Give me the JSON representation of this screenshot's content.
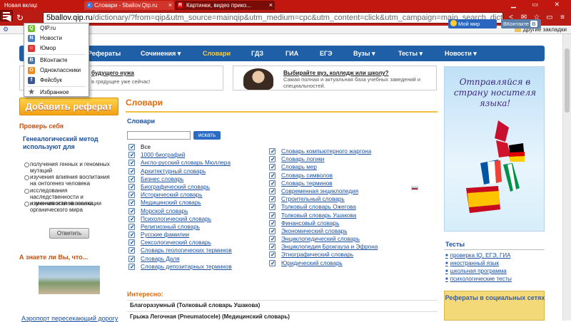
{
  "browser": {
    "tabs": [
      {
        "label": "Новая вкладка"
      },
      {
        "label": "Словари - 5ballov.Qip.ru"
      },
      {
        "label": "Картинки, видео прико..."
      }
    ],
    "url_host": "5ballov.qip.ru",
    "url_rest": "/dictionary/?from=qip&utm_source=mainqip&utm_medium=cpc&utm_content=click&utm_campaign=main_search_dictionary",
    "bookmarks_folder": "Другие закладки",
    "menu_items": [
      {
        "label": "QIP.ru",
        "icon": "qip-icon",
        "color": "#6fbf2e"
      },
      {
        "label": "Новости",
        "icon": "news-icon",
        "color": "#4a7cc9"
      },
      {
        "label": "Юмор",
        "icon": "humor-icon",
        "color": "#d33"
      },
      {
        "label": "ВКонтакте",
        "icon": "vk-icon",
        "color": "#4c75a3"
      },
      {
        "label": "Одноклассники",
        "icon": "ok-icon",
        "color": "#f08a1c"
      },
      {
        "label": "Фейсбук",
        "icon": "facebook-icon",
        "color": "#3b5998"
      },
      {
        "label": "Избранное",
        "icon": "star-icon",
        "color": "#666"
      }
    ]
  },
  "nav": {
    "items": [
      "Рефераты",
      "Сочинения ▾",
      "Словари",
      "ГДЗ",
      "ГИА",
      "ЕГЭ",
      "Вузы ▾",
      "Тесты ▾",
      "Новости ▾"
    ],
    "active": "Словари"
  },
  "banners": {
    "left_title": "будущего нужа",
    "left_text": "в грядущее уже сейчас!",
    "right_title": "Выбирайте вуз, колледж или школу?",
    "right_text": "Самая полная и актуальная база учебных заведений и специальностей."
  },
  "sidebar": {
    "add_button": "Добавить реферат",
    "check_head": "Проверь себя",
    "question": "Генеалогический метод используют для",
    "options": [
      "получения генных и геномных мутаций",
      "изучения влияния воспитания на онтогенез человека",
      "исследования наследственности и изменчивости человека",
      "изучения этапов эволюции органического мира"
    ],
    "answer_button": "Ответить",
    "know_head": "А знаете ли Вы, что...",
    "know_link": "Аэропорт пересекающий дорогу"
  },
  "main": {
    "title": "Словари",
    "subtitle": "Словари",
    "search_button": "искать",
    "left_items": [
      "Все",
      "1000 биографий",
      "Англо-русский словарь Мюллера",
      "Архитектурный словарь",
      "Бизнес словарь",
      "Биографический словарь",
      "Исторический словарь",
      "Медицинский словарь",
      "Морской словарь",
      "Психологический словарь",
      "Религиозный словарь",
      "Русские фамилии",
      "Сексологический словарь",
      "Словарь геологических терминов",
      "Словарь Даля",
      "Словарь депозитарных терминов"
    ],
    "right_items": [
      "Словарь компьютерного жаргона",
      "Словарь логики",
      "Словарь мер",
      "Словарь символов",
      "Словарь терминов",
      "Современная энциклопедия",
      "Строительный словарь",
      "Толковый словарь Ожегова",
      "Толковый словарь Ушакова",
      "Финансовый словарь",
      "Экономический словарь",
      "Энциклопедический словарь",
      "Энциклопедия Брокгауза и Эфрона",
      "Этнографический словарь",
      "Юридический словарь"
    ],
    "interest_head": "Интересно:",
    "interest_rows": [
      "Благоразумный (Толковый словарь Ушакова)",
      "Грыжа Легочная (Pneumatocele) (Медицинский словарь)"
    ]
  },
  "right": {
    "ad_text": "Отправляйся в страну носителя языка!",
    "tests_head": "Тесты",
    "tests_line1": "проверка IQ, ЕГЭ, ГИА",
    "tests_line2": "иностранный язык",
    "tests_line3": "школьная программа",
    "tests_line4": "психологические тесты",
    "social_title": "Рефераты в социальных сетях",
    "mymir": "Мой мир",
    "vk": "ВКонтакте"
  }
}
